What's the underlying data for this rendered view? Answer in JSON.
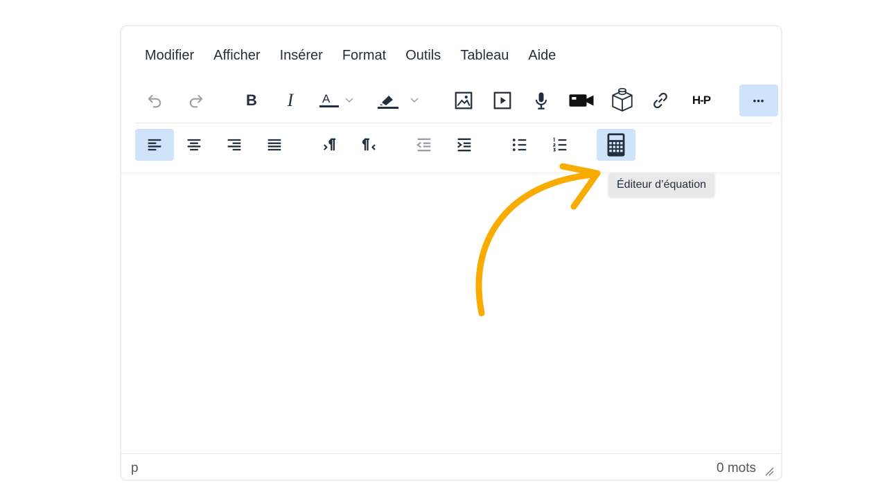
{
  "menubar": {
    "items": [
      "Modifier",
      "Afficher",
      "Insérer",
      "Format",
      "Outils",
      "Tableau",
      "Aide"
    ]
  },
  "toolbar": {
    "bold_label": "B",
    "italic_label": "I",
    "h5p_label": "H-P",
    "more_label": "•••"
  },
  "tooltip": {
    "text": "Éditeur d’équation"
  },
  "statusbar": {
    "path": "p",
    "word_count": "0 mots"
  },
  "colors": {
    "accent_active": "#cfe3fa",
    "annotation_arrow": "#f9ab00",
    "text": "#222f3e"
  },
  "icons": [
    "undo-icon",
    "redo-icon",
    "bold-icon",
    "italic-icon",
    "text-color-icon",
    "highlight-icon",
    "image-icon",
    "media-icon",
    "microphone-icon",
    "video-camera-icon",
    "3d-cube-icon",
    "link-icon",
    "h5p-icon",
    "more-icon",
    "align-left-icon",
    "align-center-icon",
    "align-right-icon",
    "justify-icon",
    "ltr-icon",
    "rtl-icon",
    "outdent-icon",
    "indent-icon",
    "bullet-list-icon",
    "numbered-list-icon",
    "calculator-icon",
    "resize-handle-icon"
  ]
}
